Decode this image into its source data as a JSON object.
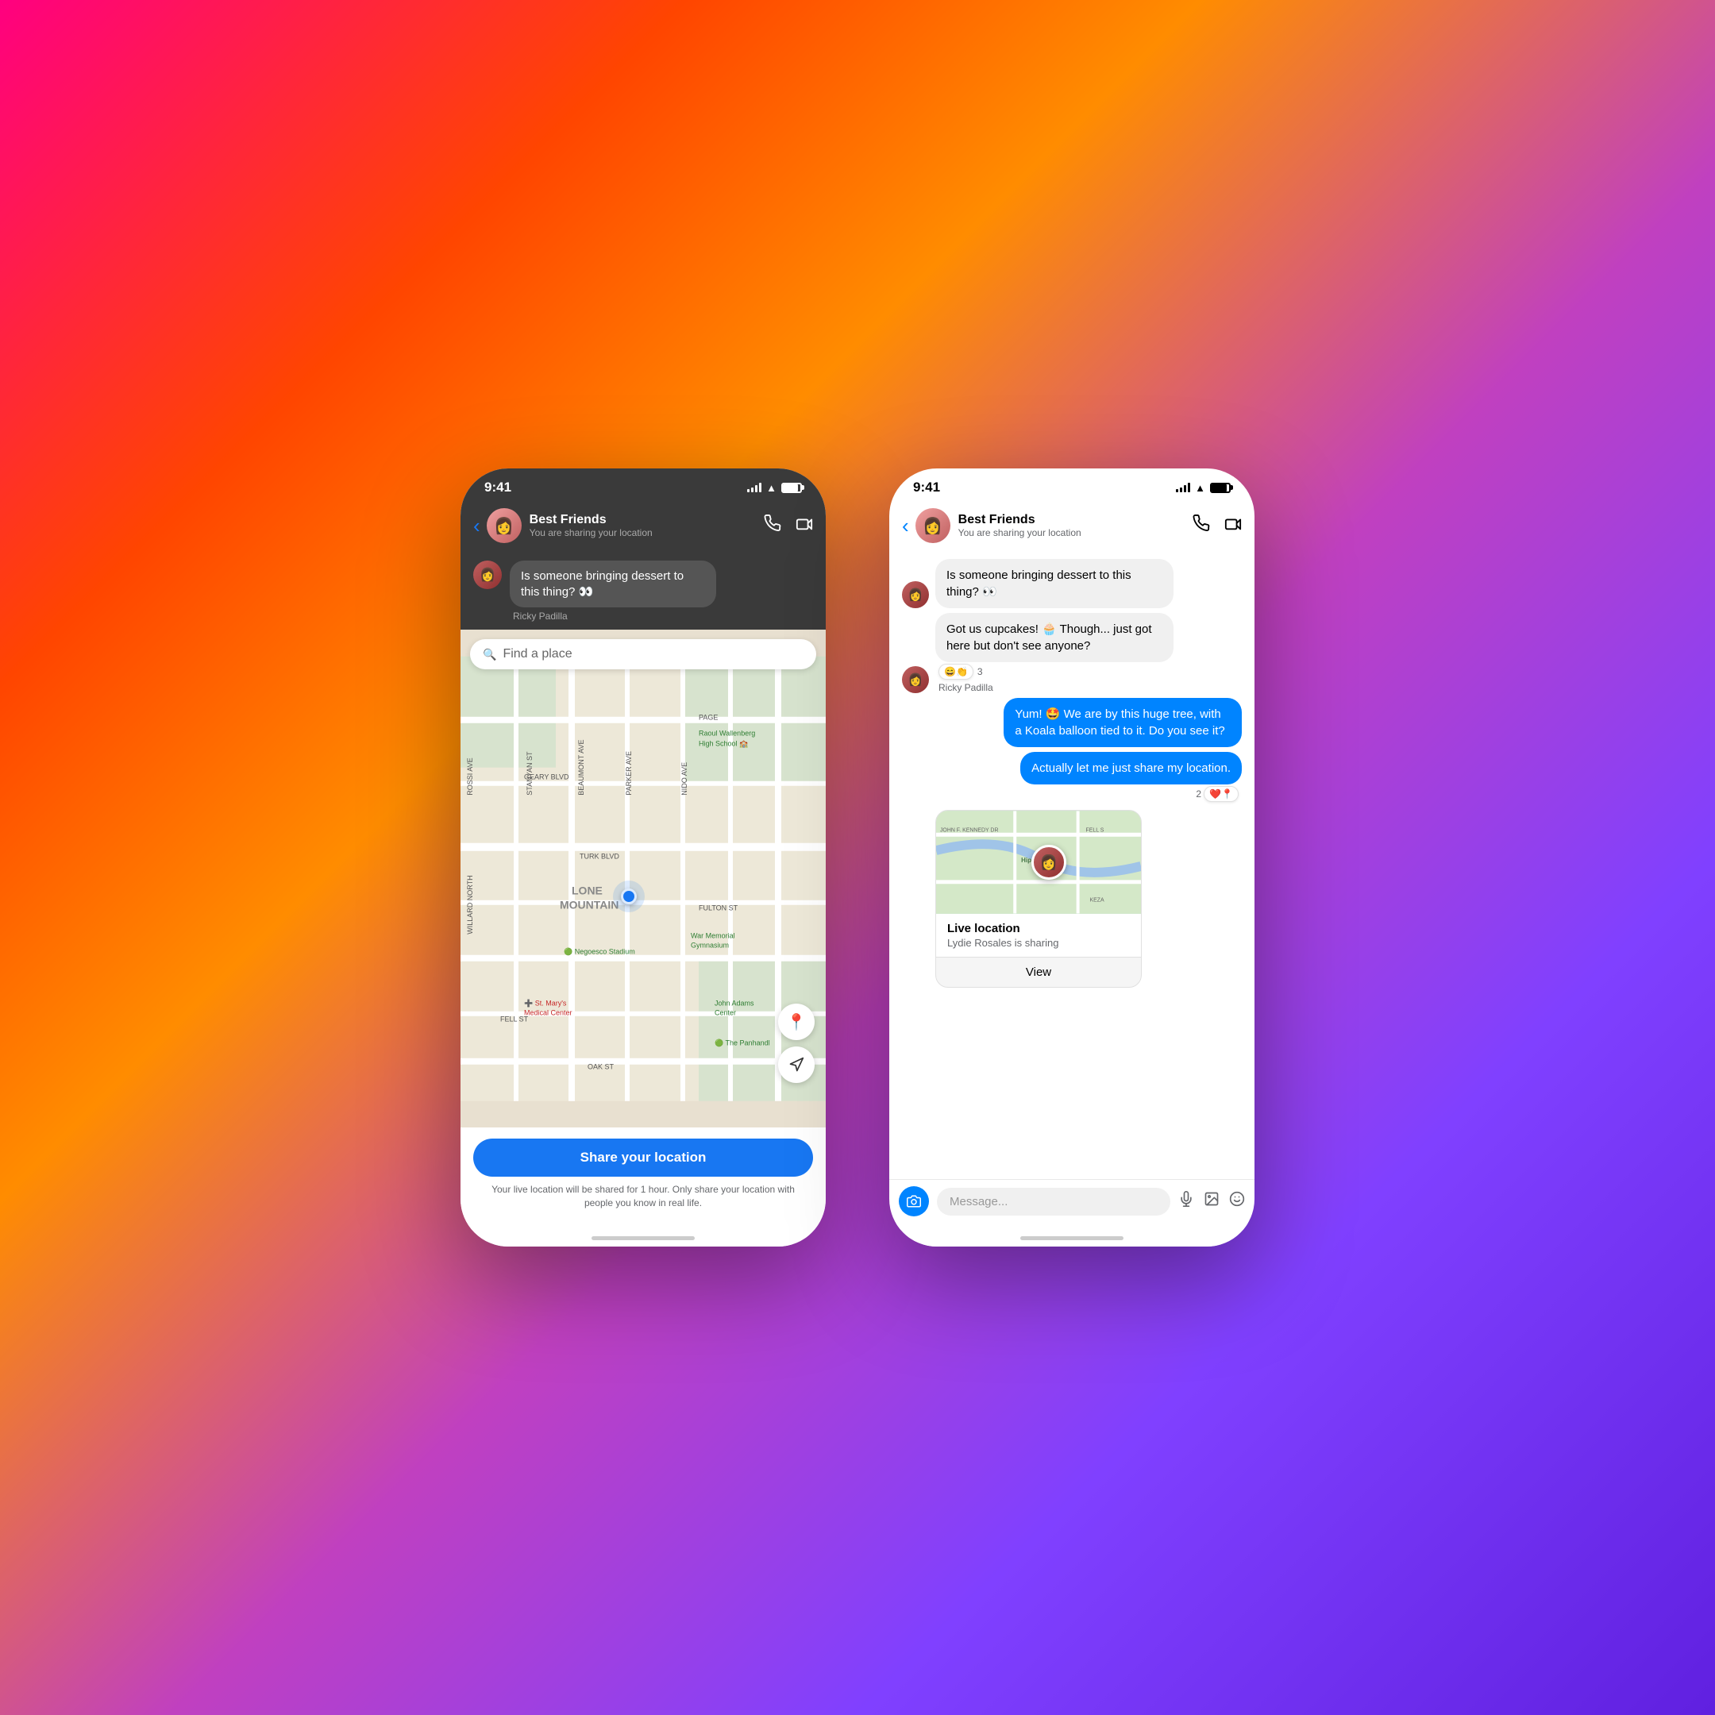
{
  "phone1": {
    "status": {
      "time": "9:41",
      "signal": "signal",
      "wifi": "wifi",
      "battery": "battery"
    },
    "header": {
      "back_label": "‹",
      "group_name": "Best Friends",
      "subtitle": "You are sharing your location",
      "call_icon": "phone",
      "video_icon": "video"
    },
    "dark_message": {
      "text": "Is someone bringing dessert to this thing? 👀",
      "sender": "Ricky Padilla"
    },
    "search": {
      "placeholder": "Find a place",
      "icon": "🔍"
    },
    "map": {
      "places": [
        {
          "name": "Raoul Wallenberg\nHigh School",
          "type": "school",
          "color": "green"
        },
        {
          "name": "Negoesco Stadium",
          "type": "stadium",
          "color": "green"
        },
        {
          "name": "War Memorial\nGymnasium",
          "type": "gym",
          "color": "green"
        },
        {
          "name": "St. Mary's\nMedical Center",
          "type": "hospital",
          "color": "red"
        },
        {
          "name": "John Adams\nCenter",
          "type": "center",
          "color": "green"
        },
        {
          "name": "The Panhandl",
          "type": "park",
          "color": "green"
        },
        {
          "name": "LONE\nMOUNTAIN",
          "type": "area"
        },
        {
          "name": "TURK BLVD",
          "type": "street"
        },
        {
          "name": "FULTON ST",
          "type": "street"
        },
        {
          "name": "FELL ST",
          "type": "street"
        },
        {
          "name": "OAK ST",
          "type": "street"
        }
      ]
    },
    "share_button": {
      "label": "Share your location"
    },
    "disclaimer": "Your live location will be shared for 1 hour. Only share your location with people you know in real life."
  },
  "phone2": {
    "status": {
      "time": "9:41"
    },
    "header": {
      "back_label": "‹",
      "group_name": "Best Friends",
      "subtitle": "You are sharing your location"
    },
    "messages": [
      {
        "id": "msg1",
        "sender": "Ricky Padilla",
        "text": "Is someone bringing dessert to this thing? 👀",
        "type": "incoming"
      },
      {
        "id": "msg2",
        "sender": "Ricky Padilla",
        "text": "Got us cupcakes! 🧁 Though... just got here but don't see anyone?",
        "type": "incoming",
        "reactions": "😄👏 3"
      },
      {
        "id": "msg3",
        "text": "Yum! 🤩 We are by this huge tree, with a Koala balloon tied to it. Do you see it?",
        "type": "outgoing"
      },
      {
        "id": "msg4",
        "text": "Actually let me just share my location.",
        "type": "outgoing",
        "reactions": "❤️📍 2"
      }
    ],
    "live_location": {
      "title": "Live location",
      "subtitle": "Lydie Rosales is sharing",
      "view_label": "View",
      "map_labels": [
        "JOHN F. KENNEDY DR",
        "Hippie Hill",
        "FELL S",
        "KEZA"
      ]
    },
    "input": {
      "placeholder": "Message...",
      "camera_icon": "📷",
      "mic_icon": "🎤",
      "gallery_icon": "🖼",
      "sticker_icon": "🙂"
    }
  }
}
